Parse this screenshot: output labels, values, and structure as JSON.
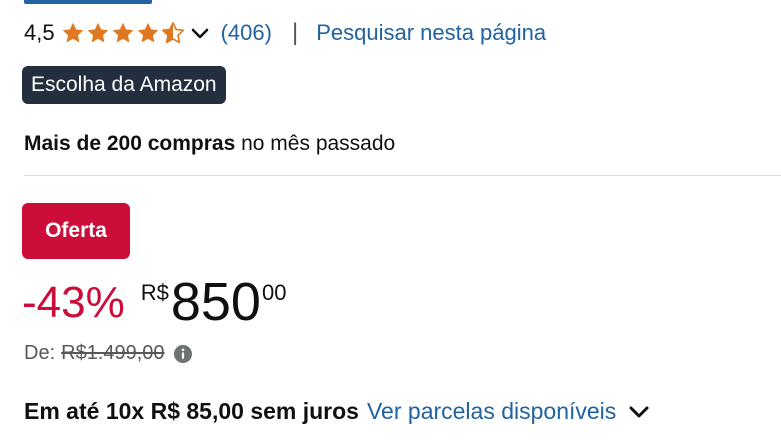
{
  "rating": {
    "value": "4,5",
    "stars": 4.5,
    "star_color": "#de7921",
    "count": "(406)",
    "chevron_icon": "chevron-down-icon"
  },
  "search_link": "Pesquisar nesta página",
  "badge": {
    "label": "Escolha da Amazon",
    "color": "#232f3e"
  },
  "bought": {
    "bold": "Mais de 200 compras",
    "rest": " no mês passado"
  },
  "deal": {
    "label": "Oferta",
    "color": "#cc0c39"
  },
  "price": {
    "discount": "-43%",
    "currency": "R$",
    "whole": "850",
    "fraction": "00"
  },
  "list_price": {
    "label": "De:",
    "value": "R$1.499,00",
    "info_icon": "info-icon"
  },
  "installments": {
    "text": "Em até 10x R$ 85,00 sem juros",
    "link": "Ver parcelas disponíveis",
    "chevron_icon": "chevron-down-icon"
  },
  "colors": {
    "link": "#2162a1",
    "text": "#0f1111",
    "muted": "#565959"
  }
}
